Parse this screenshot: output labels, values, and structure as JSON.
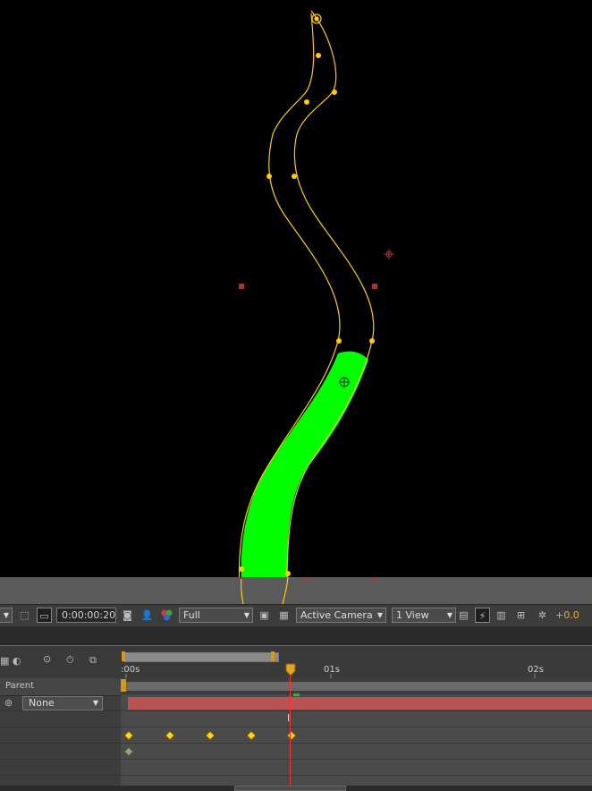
{
  "viewer_toolbar": {
    "timecode": "0:00:00:20",
    "resolution": "Full",
    "camera": "Active Camera",
    "view_layout": "1 View",
    "exposure": "+0.0"
  },
  "layer_panel": {
    "parent_header": "Parent",
    "parent_value": "None"
  },
  "ruler": {
    "labels": [
      ":00s",
      "01s",
      "02s"
    ]
  },
  "colors": {
    "shape_fill": "#00ff00",
    "path_stroke": "#ffcc00",
    "playhead": "#ff3030",
    "work_area_bar": "#b85454",
    "keyframe": "#ffd21e"
  },
  "keyframes": {
    "row1_frames": [
      0,
      5,
      10,
      15,
      20
    ],
    "row2_frames": [
      0
    ]
  }
}
